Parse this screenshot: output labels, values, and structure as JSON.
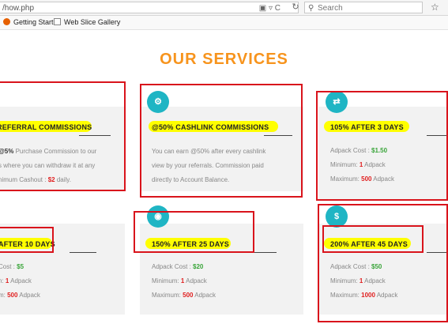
{
  "browser": {
    "url": "/how.php",
    "search_placeholder": "Search",
    "bookmarks": [
      "Getting Started",
      "Web Slice Gallery"
    ]
  },
  "page": {
    "heading": "OUR SERVICES"
  },
  "cards": [
    {
      "title": "REFERRAL COMMISSIONS",
      "icon": "none",
      "line1_pre": "@5%",
      "line1_post": " Purchase Commission to our",
      "line2": "s where you can withdraw it at any",
      "line3_label": "nimum Cashout : ",
      "line3_value": "$2",
      "line3_post": " daily."
    },
    {
      "title": "@50% CASHLINK COMMISSIONS",
      "icon": "gear-icon",
      "line1": "You can earn @50% after every cashlink",
      "line2": "view by your referrals. Commission paid",
      "line3": "directly to Account Balance."
    },
    {
      "title": "105% AFTER 3 DAYS",
      "icon": "refresh-icon",
      "cost_label": "Adpack Cost : ",
      "cost_value": "$1.50",
      "min_label": "Minimum: ",
      "min_value": "1",
      "min_unit": " Adpack",
      "max_label": "Maximum: ",
      "max_value": "500",
      "max_unit": " Adpack"
    },
    {
      "title": "AFTER 10 DAYS",
      "icon": "none",
      "cost_label": "Cost : ",
      "cost_value": "$5",
      "min_label": "n: ",
      "min_value": "1",
      "min_unit": " Adpack",
      "max_label": "m: ",
      "max_value": "500",
      "max_unit": " Adpack"
    },
    {
      "title": "150% AFTER 25 DAYS",
      "icon": "eye-icon",
      "cost_label": "Adpack Cost : ",
      "cost_value": "$20",
      "min_label": "Minimum: ",
      "min_value": "1",
      "min_unit": " Adpack",
      "max_label": "Maximum: ",
      "max_value": "500",
      "max_unit": " Adpack"
    },
    {
      "title": "200% AFTER 45 DAYS",
      "icon": "dollar-icon",
      "cost_label": "Adpack Cost : ",
      "cost_value": "$50",
      "min_label": "Minimum: ",
      "min_value": "1",
      "min_unit": " Adpack",
      "max_label": "Maximum: ",
      "max_value": "1000",
      "max_unit": " Adpack"
    }
  ],
  "colors": {
    "accent_orange": "#f7941d",
    "icon_teal": "#1fb5c4",
    "highlight_yellow": "#ffff00",
    "annotation_red": "#d9141c"
  }
}
